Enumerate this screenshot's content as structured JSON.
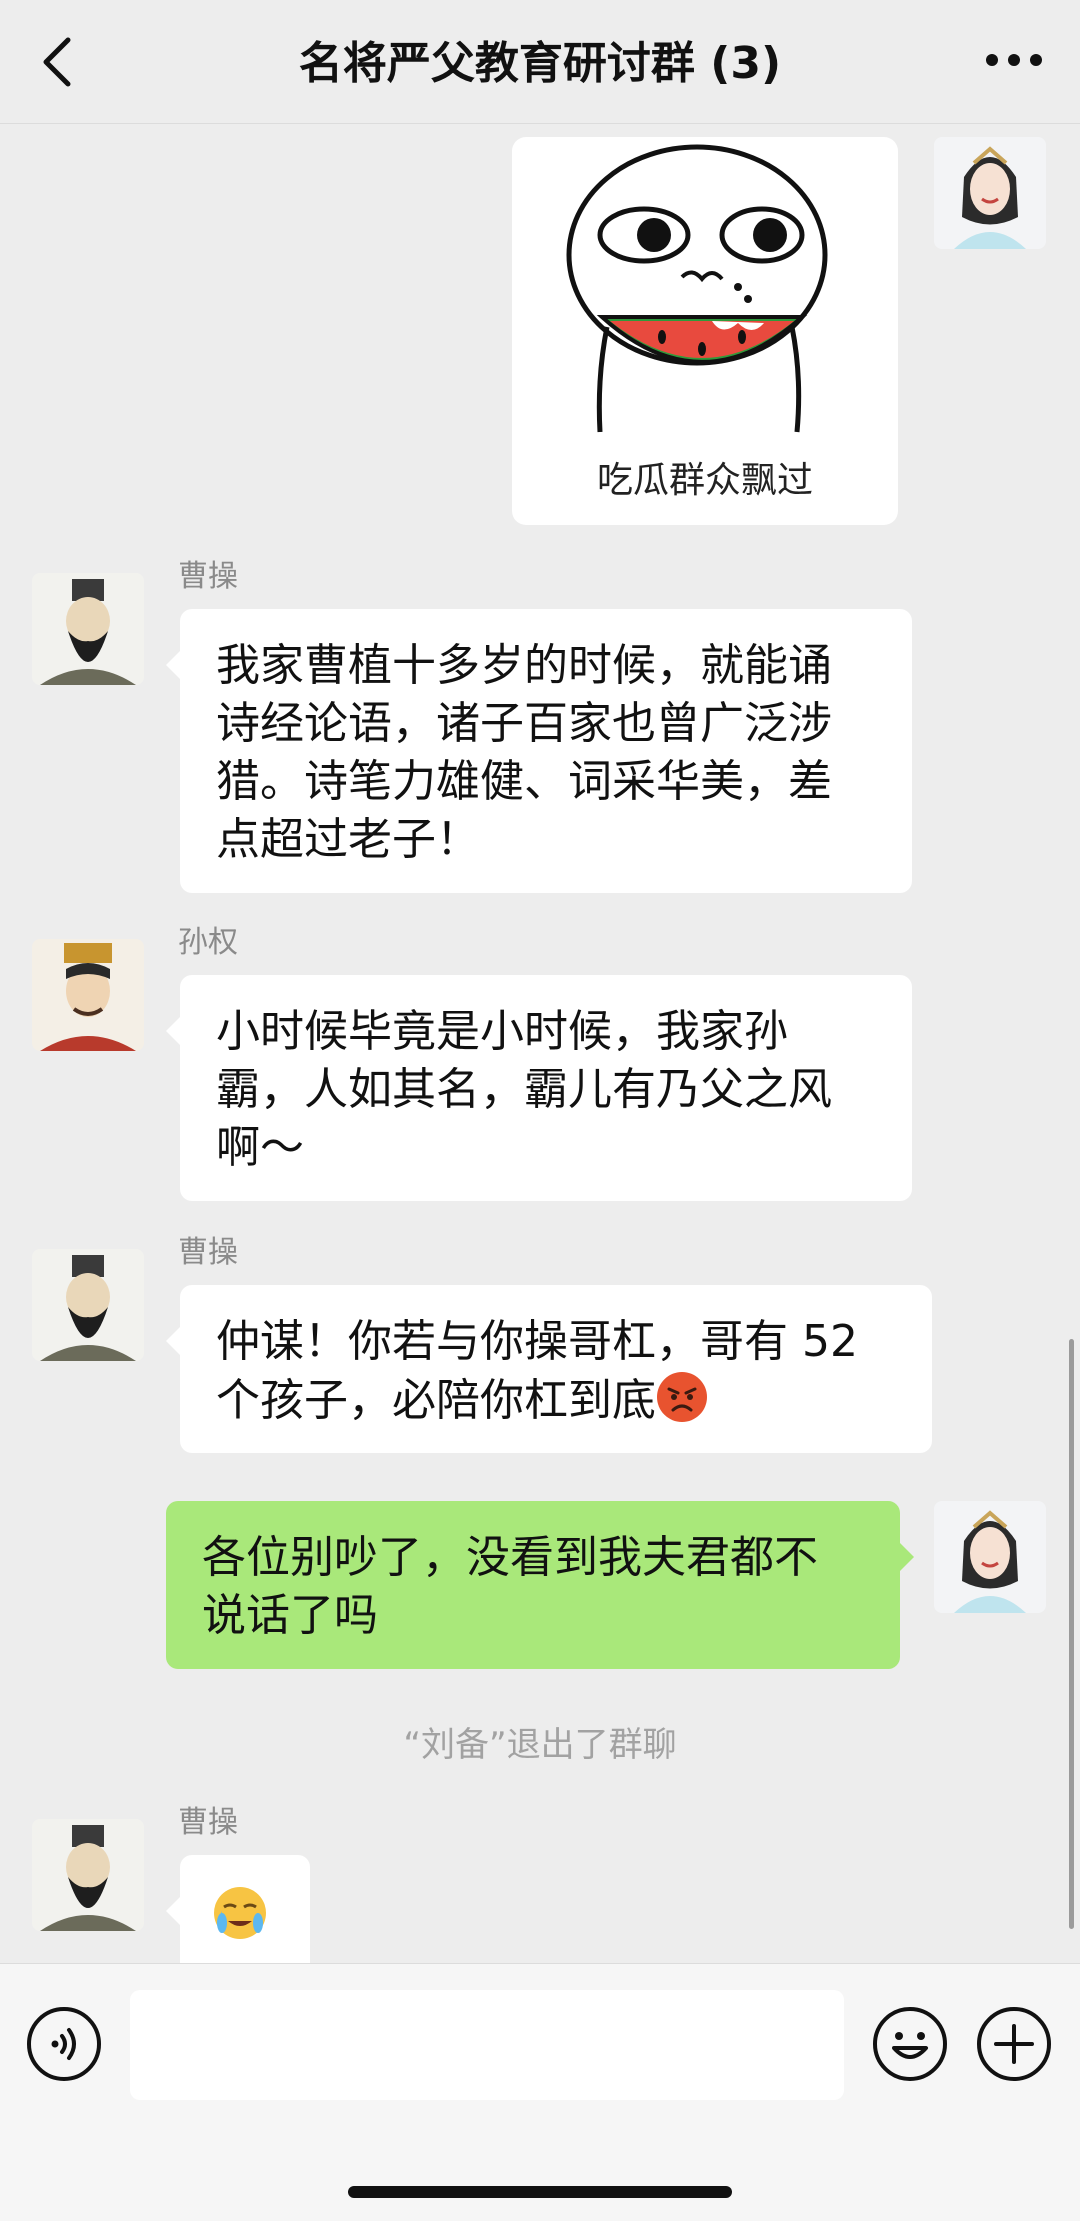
{
  "header": {
    "title": "名将严父教育研讨群 (3)",
    "back_icon": "chevron-left-icon",
    "more_icon": "ellipsis-icon"
  },
  "messages": [
    {
      "type": "sticker",
      "side": "right",
      "caption": "吃瓜群众飘过"
    },
    {
      "type": "text",
      "side": "left",
      "sender": "曹操",
      "lines": [
        "我家曹植十多岁的时候，就能诵",
        "诗经论语，诸子百家也曾广泛涉",
        "猎。诗笔力雄健、词采华美，差",
        "点超过老子！"
      ]
    },
    {
      "type": "text",
      "side": "left",
      "sender": "孙权",
      "lines": [
        "小时候毕竟是小时候，我家孙",
        "霸，人如其名，霸儿有乃父之风",
        "啊～"
      ]
    },
    {
      "type": "text",
      "side": "left",
      "sender": "曹操",
      "lines": [
        "仲谋！你若与你操哥杠，哥有 52",
        "个孩子，必陪你杠到底"
      ],
      "emoji": "angry-face-icon"
    },
    {
      "type": "text",
      "side": "right",
      "lines": [
        "各位别吵了，没看到我夫君都不",
        "说话了吗"
      ]
    },
    {
      "type": "system",
      "text": "“刘备”退出了群聊"
    },
    {
      "type": "emoji",
      "side": "left",
      "sender": "曹操",
      "emoji": "crying-face-icon"
    }
  ],
  "bottom_bar": {
    "voice_icon": "voice-icon",
    "emoji_icon": "smiley-icon",
    "plus_icon": "plus-circle-icon",
    "input_value": ""
  },
  "colors": {
    "background": "#ededed",
    "own_bubble": "#a9e87a",
    "other_bubble": "#ffffff"
  }
}
